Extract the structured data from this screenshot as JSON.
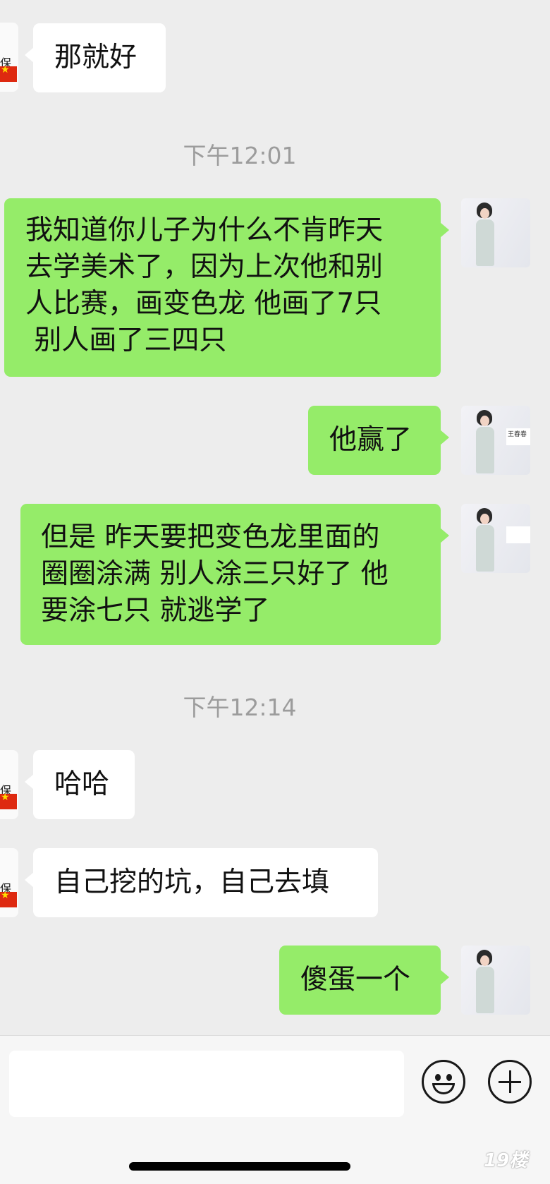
{
  "messages": [
    {
      "side": "left",
      "text": "那就好"
    },
    {
      "side": "time",
      "text": "下午12:01"
    },
    {
      "side": "right",
      "lines": [
        "我知道你儿子为什么不肯昨天",
        "去学美术了，因为上次他和别",
        "人比赛，画变色龙 他画了7只",
        " 别人画了三四只"
      ]
    },
    {
      "side": "right",
      "text": "他赢了"
    },
    {
      "side": "right",
      "lines": [
        "但是 昨天要把变色龙里面的",
        "圈圈涂满 别人涂三只好了 他",
        "要涂七只 就逃学了"
      ]
    },
    {
      "side": "time",
      "text": "下午12:14"
    },
    {
      "side": "left",
      "text": "哈哈"
    },
    {
      "side": "left",
      "text": "自己挖的坑，自己去填"
    },
    {
      "side": "right",
      "text": "傻蛋一个"
    }
  ],
  "avatars": {
    "left_partial_text": "保",
    "right_name": "王春春"
  },
  "input": {
    "placeholder": ""
  },
  "icons": {
    "emoji": "smiley-icon",
    "more": "plus-circle-icon"
  },
  "watermark": "19楼",
  "colors": {
    "background": "#ededed",
    "bubble_self": "#95ec69",
    "bubble_other": "#ffffff",
    "timestamp": "#9c9c9c"
  }
}
